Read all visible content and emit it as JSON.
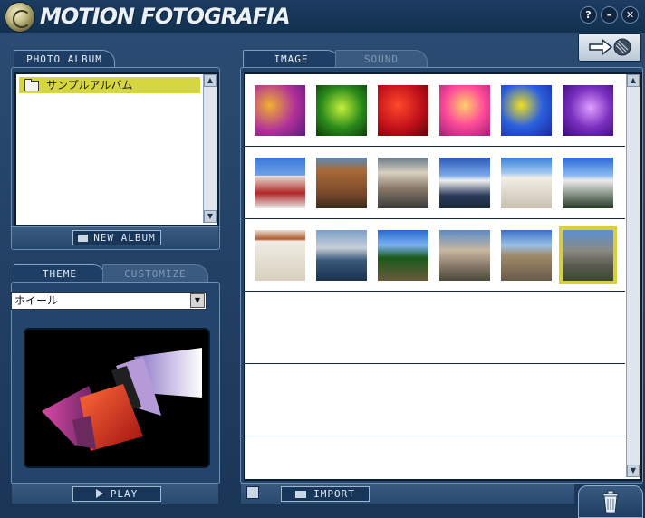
{
  "app": {
    "title": "MOTION FOTOGRAFIA"
  },
  "window_buttons": {
    "help": "?",
    "minimize": "–",
    "close": "✕"
  },
  "album_panel": {
    "tab_label": "PHOTO ALBUM",
    "albums": [
      {
        "name": "サンプルアルバム",
        "selected": true
      }
    ],
    "new_album_label": "NEW ALBUM"
  },
  "theme_panel": {
    "tabs": [
      {
        "label": "THEME",
        "active": true
      },
      {
        "label": "CUSTOMIZE",
        "active": false
      }
    ],
    "selected_theme": "ホイール",
    "play_label": "PLAY"
  },
  "media_panel": {
    "tabs": [
      {
        "label": "IMAGE",
        "active": true
      },
      {
        "label": "SOUND",
        "active": false
      }
    ],
    "import_label": "IMPORT",
    "selected_thumbnail": "row3-6"
  },
  "icons": [
    "logo-icon",
    "export-arrow-icon",
    "folder-icon",
    "trash-icon",
    "play-icon",
    "import-folder-icon",
    "scroll-up-icon",
    "scroll-down-icon",
    "dropdown-arrow-icon",
    "slideshow-icon"
  ],
  "colors": {
    "selection": "#d7d03a",
    "panel": "#23456c",
    "frame": "#1a3556"
  }
}
